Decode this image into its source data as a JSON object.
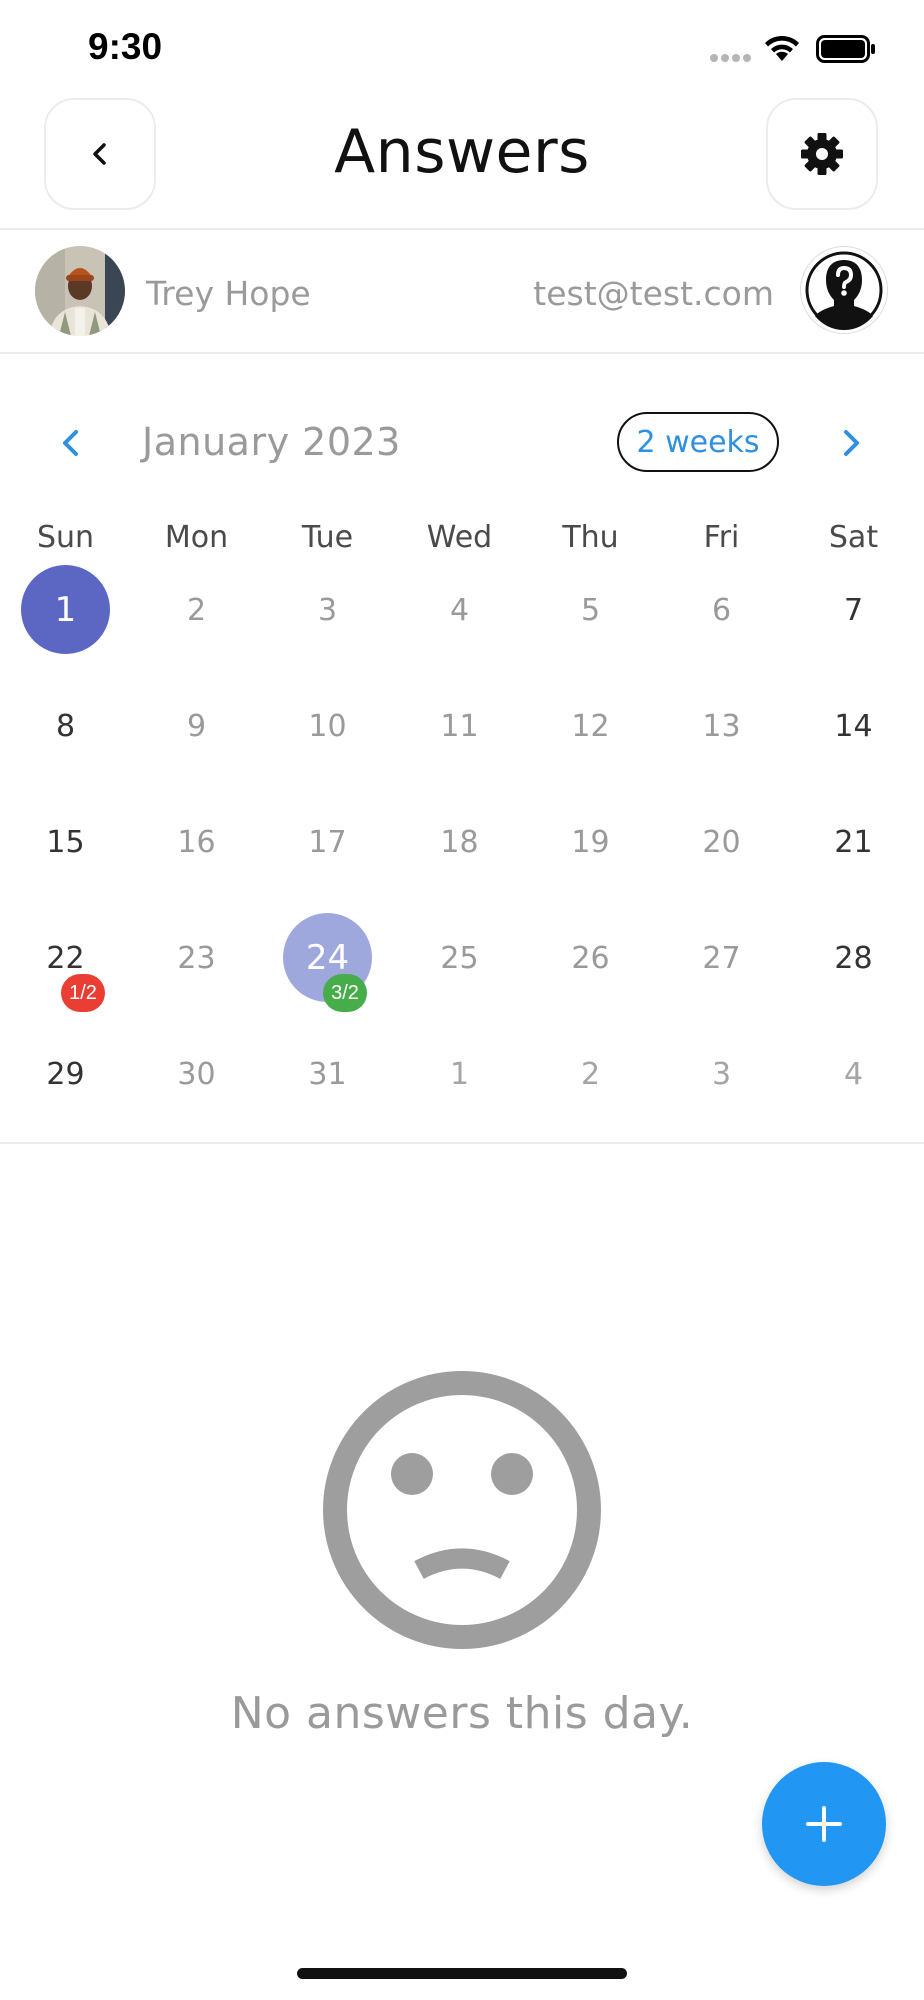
{
  "status_bar": {
    "time": "9:30"
  },
  "header": {
    "title": "Answers"
  },
  "user": {
    "name": "Trey Hope",
    "email": "test@test.com"
  },
  "calendar": {
    "month_label": "January 2023",
    "range_toggle": "2 weeks",
    "weekdays": [
      "Sun",
      "Mon",
      "Tue",
      "Wed",
      "Thu",
      "Fri",
      "Sat"
    ],
    "weeks": [
      [
        {
          "day": "1",
          "state": "today"
        },
        {
          "day": "2"
        },
        {
          "day": "3"
        },
        {
          "day": "4"
        },
        {
          "day": "5"
        },
        {
          "day": "6"
        },
        {
          "day": "7"
        }
      ],
      [
        {
          "day": "8"
        },
        {
          "day": "9"
        },
        {
          "day": "10"
        },
        {
          "day": "11"
        },
        {
          "day": "12"
        },
        {
          "day": "13"
        },
        {
          "day": "14"
        }
      ],
      [
        {
          "day": "15"
        },
        {
          "day": "16"
        },
        {
          "day": "17"
        },
        {
          "day": "18"
        },
        {
          "day": "19"
        },
        {
          "day": "20"
        },
        {
          "day": "21"
        }
      ],
      [
        {
          "day": "22",
          "badge": "1/2",
          "badge_color": "#ea3e34"
        },
        {
          "day": "23"
        },
        {
          "day": "24",
          "state": "selected",
          "badge": "3/2",
          "badge_color": "#47ad4b"
        },
        {
          "day": "25"
        },
        {
          "day": "26"
        },
        {
          "day": "27"
        },
        {
          "day": "28"
        }
      ],
      [
        {
          "day": "29"
        },
        {
          "day": "30"
        },
        {
          "day": "31"
        },
        {
          "day": "1",
          "other_month": true
        },
        {
          "day": "2",
          "other_month": true
        },
        {
          "day": "3",
          "other_month": true
        },
        {
          "day": "4",
          "other_month": true
        }
      ]
    ]
  },
  "empty_state": {
    "icon": "sad-face-icon",
    "message": "No answers this day."
  },
  "fab": {
    "icon": "plus-icon"
  },
  "colors": {
    "accent": "#2196f3",
    "today": "#5c67c3",
    "selected": "#9fa8dd",
    "badge_red": "#ea3e34",
    "badge_green": "#47ad4b"
  }
}
